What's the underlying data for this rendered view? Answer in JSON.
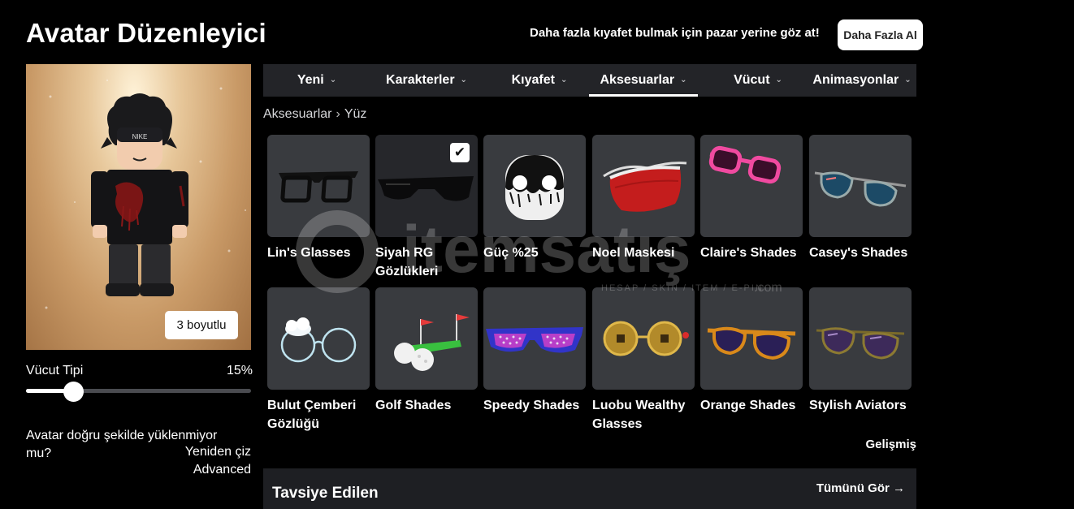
{
  "header": {
    "title": "Avatar Düzenleyici",
    "promo_text": "Daha fazla kıyafet bulmak için pazar yerine göz at!",
    "buy_more_label": "Daha Fazla Al"
  },
  "avatar": {
    "view_3d_label": "3 boyutlu",
    "shirt_text": "NIKE"
  },
  "body_type": {
    "label": "Vücut Tipi",
    "value": "15%",
    "value_fraction": 0.15
  },
  "help": {
    "load_issue": "Avatar doğru şekilde yüklenmiyor mu?",
    "redraw_label": "Yeniden çiz",
    "advanced_label": "Advanced"
  },
  "tabs": [
    {
      "label": "Yeni",
      "active": false
    },
    {
      "label": "Karakterler",
      "active": false
    },
    {
      "label": "Kıyafet",
      "active": false
    },
    {
      "label": "Aksesuarlar",
      "active": true
    },
    {
      "label": "Vücut",
      "active": false
    },
    {
      "label": "Animasyonlar",
      "active": false
    }
  ],
  "breadcrumb": {
    "parent": "Aksesuarlar",
    "current": "Yüz"
  },
  "items": [
    {
      "name": "Lin's Glasses",
      "selected": false,
      "icon": "black-glasses-icon"
    },
    {
      "name": "Siyah RG Gözlükleri",
      "selected": true,
      "icon": "black-sunglasses-icon"
    },
    {
      "name": "Güç %25",
      "selected": false,
      "icon": "face-mask-head-icon"
    },
    {
      "name": "Noel Maskesi",
      "selected": false,
      "icon": "red-face-mask-icon"
    },
    {
      "name": "Claire's Shades",
      "selected": false,
      "icon": "pink-shades-icon"
    },
    {
      "name": "Casey's Shades",
      "selected": false,
      "icon": "blue-aviators-icon"
    },
    {
      "name": "Bulut Çemberi Gözlüğü",
      "selected": false,
      "icon": "cloud-glasses-icon"
    },
    {
      "name": "Golf Shades",
      "selected": false,
      "icon": "golf-shades-icon"
    },
    {
      "name": "Speedy Shades",
      "selected": false,
      "icon": "speedy-shades-icon"
    },
    {
      "name": "Luobu Wealthy Glasses",
      "selected": false,
      "icon": "coin-glasses-icon"
    },
    {
      "name": "Orange Shades",
      "selected": false,
      "icon": "orange-shades-icon"
    },
    {
      "name": "Stylish Aviators",
      "selected": false,
      "icon": "stylish-aviators-icon"
    }
  ],
  "advanced_filter_label": "Gelişmiş",
  "recommended": {
    "title": "Tavsiye Edilen",
    "see_all_label": "Tümünü Gör"
  },
  "watermark": {
    "brand": "itemsatış",
    "tagline": "HESAP / SKIN / ITEM / E-PIN",
    "domain": ".com"
  },
  "colors": {
    "background": "#000000",
    "tab_bar": "#232428",
    "item_tile": "#393b3f",
    "item_tile_selected": "#26272b",
    "recommended_bar": "#1e1f23"
  }
}
